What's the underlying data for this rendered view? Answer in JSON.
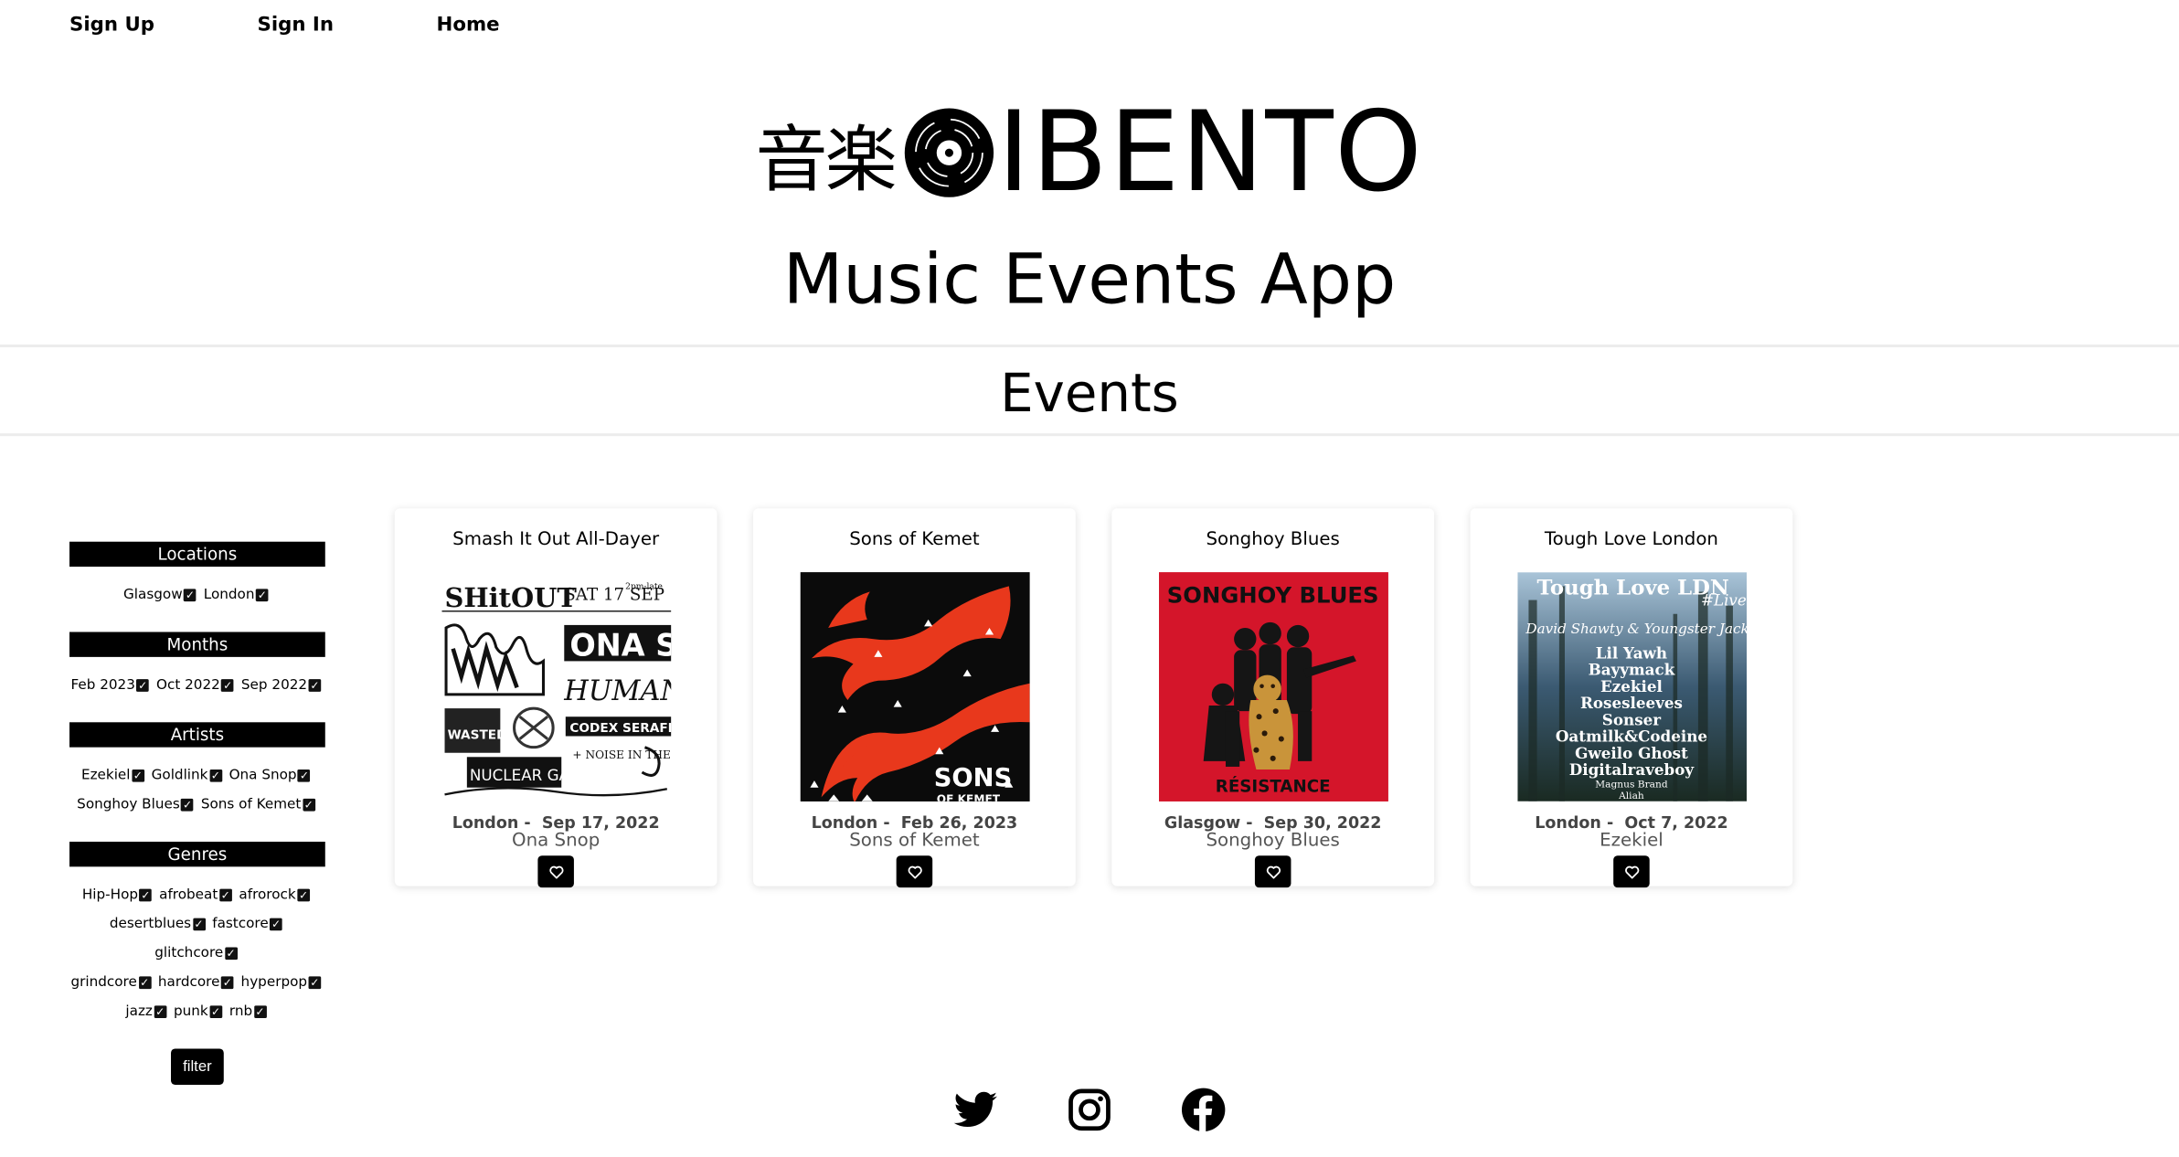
{
  "nav": [
    {
      "label": "Sign Up"
    },
    {
      "label": "Sign In"
    },
    {
      "label": "Home"
    }
  ],
  "logo": {
    "kanji": "音楽",
    "word": "IBENTO",
    "icon": "vinyl-record-icon"
  },
  "subtitle": "Music Events App",
  "section_title": "Events",
  "filters": {
    "groups": [
      {
        "title": "Locations",
        "rows": [
          [
            {
              "label": "Glasgow",
              "checked": true
            },
            {
              "label": "London",
              "checked": true
            }
          ]
        ]
      },
      {
        "title": "Months",
        "rows": [
          [
            {
              "label": "Feb 2023",
              "checked": true
            },
            {
              "label": "Oct 2022",
              "checked": true
            },
            {
              "label": "Sep 2022",
              "checked": true
            }
          ]
        ]
      },
      {
        "title": "Artists",
        "rows": [
          [
            {
              "label": "Ezekiel",
              "checked": true
            },
            {
              "label": "Goldlink",
              "checked": true
            },
            {
              "label": "Ona Snop",
              "checked": true
            }
          ],
          [
            {
              "label": "Songhoy Blues",
              "checked": true
            },
            {
              "label": "Sons of Kemet",
              "checked": true
            }
          ]
        ]
      },
      {
        "title": "Genres",
        "rows": [
          [
            {
              "label": "Hip-Hop",
              "checked": true
            },
            {
              "label": "afrobeat",
              "checked": true
            },
            {
              "label": "afrorock",
              "checked": true
            }
          ],
          [
            {
              "label": "desertblues",
              "checked": true
            },
            {
              "label": "fastcore",
              "checked": true
            },
            {
              "label": "glitchcore",
              "checked": true
            }
          ],
          [
            {
              "label": "grindcore",
              "checked": true
            },
            {
              "label": "hardcore",
              "checked": true
            },
            {
              "label": "hyperpop",
              "checked": true
            }
          ],
          [
            {
              "label": "jazz",
              "checked": true
            },
            {
              "label": "punk",
              "checked": true
            },
            {
              "label": "rnb",
              "checked": true
            }
          ]
        ]
      }
    ],
    "button_label": "filter"
  },
  "events": [
    {
      "title": "Smash It Out All-Dayer",
      "location": "London",
      "date": "Sep 17, 2022",
      "artist": "Ona Snop",
      "poster": "smash-it-out-poster",
      "poster_text": {
        "top": "SHitOUT",
        "date": "SAT 17 SEP",
        "late": "2pm-late",
        "band1": "ONA S",
        "band2": "HUMAN L",
        "band3": "CODEX SERAFINI",
        "band4": "NUCLEAR GANDHI",
        "band5": "+ NOISE IN THE SHED",
        "band6": "WASTED DEATH"
      }
    },
    {
      "title": "Sons of Kemet",
      "location": "London",
      "date": "Feb 26, 2023",
      "artist": "Sons of Kemet",
      "poster": "sons-of-kemet-artwork",
      "poster_text": {
        "name1": "SONS",
        "name2": "OF KEMET"
      }
    },
    {
      "title": "Songhoy Blues",
      "location": "Glasgow",
      "date": "Sep 30, 2022",
      "artist": "Songhoy Blues",
      "poster": "songhoy-blues-resistance-cover",
      "poster_text": {
        "band": "SONGHOY BLUES",
        "album": "RÉSISTANCE"
      }
    },
    {
      "title": "Tough Love London",
      "location": "London",
      "date": "Oct 7, 2022",
      "artist": "Ezekiel",
      "poster": "tough-love-poster",
      "poster_text": {
        "head": "Tough Love LDN",
        "live": "#Live",
        "lines": [
          "David Shawty & Youngster Jack",
          "Lil Yawh",
          "Bayymack",
          "Ezekiel",
          "Rosesleeves",
          "Sonser",
          "Oatmilk&Codeine",
          "Gweilo Ghost",
          "Digitalraveboy",
          "Magnus Brand",
          "Aliah"
        ]
      }
    }
  ],
  "social": [
    {
      "icon": "twitter-icon"
    },
    {
      "icon": "instagram-icon"
    },
    {
      "icon": "facebook-icon"
    }
  ],
  "colors": {
    "accent": "#000000",
    "card_shadow": "#e0e0e0",
    "kemet_orange": "#e8381c",
    "songhoy_red": "#d4152a"
  }
}
